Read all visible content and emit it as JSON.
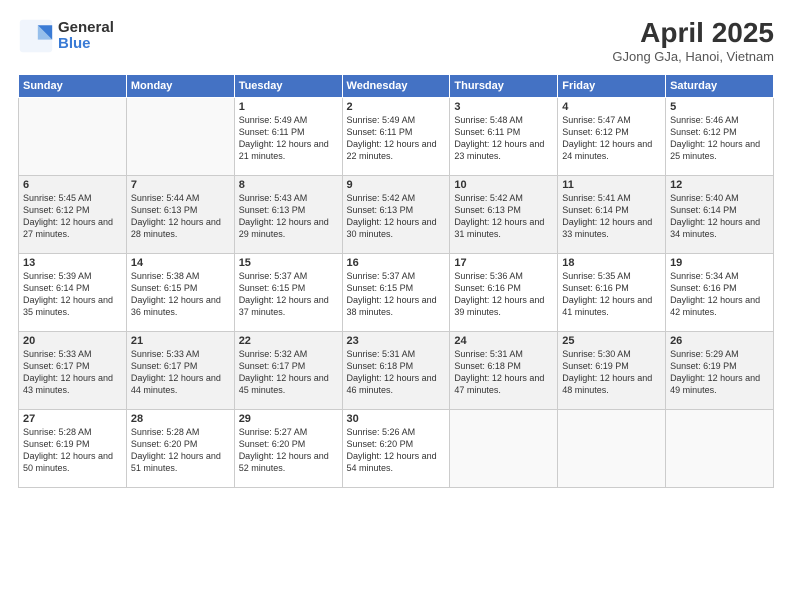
{
  "logo": {
    "general": "General",
    "blue": "Blue"
  },
  "title": "April 2025",
  "subtitle": "GJong GJa, Hanoi, Vietnam",
  "days_of_week": [
    "Sunday",
    "Monday",
    "Tuesday",
    "Wednesday",
    "Thursday",
    "Friday",
    "Saturday"
  ],
  "weeks": [
    [
      {
        "day": "",
        "info": ""
      },
      {
        "day": "",
        "info": ""
      },
      {
        "day": "1",
        "info": "Sunrise: 5:49 AM\nSunset: 6:11 PM\nDaylight: 12 hours and 21 minutes."
      },
      {
        "day": "2",
        "info": "Sunrise: 5:49 AM\nSunset: 6:11 PM\nDaylight: 12 hours and 22 minutes."
      },
      {
        "day": "3",
        "info": "Sunrise: 5:48 AM\nSunset: 6:11 PM\nDaylight: 12 hours and 23 minutes."
      },
      {
        "day": "4",
        "info": "Sunrise: 5:47 AM\nSunset: 6:12 PM\nDaylight: 12 hours and 24 minutes."
      },
      {
        "day": "5",
        "info": "Sunrise: 5:46 AM\nSunset: 6:12 PM\nDaylight: 12 hours and 25 minutes."
      }
    ],
    [
      {
        "day": "6",
        "info": "Sunrise: 5:45 AM\nSunset: 6:12 PM\nDaylight: 12 hours and 27 minutes."
      },
      {
        "day": "7",
        "info": "Sunrise: 5:44 AM\nSunset: 6:13 PM\nDaylight: 12 hours and 28 minutes."
      },
      {
        "day": "8",
        "info": "Sunrise: 5:43 AM\nSunset: 6:13 PM\nDaylight: 12 hours and 29 minutes."
      },
      {
        "day": "9",
        "info": "Sunrise: 5:42 AM\nSunset: 6:13 PM\nDaylight: 12 hours and 30 minutes."
      },
      {
        "day": "10",
        "info": "Sunrise: 5:42 AM\nSunset: 6:13 PM\nDaylight: 12 hours and 31 minutes."
      },
      {
        "day": "11",
        "info": "Sunrise: 5:41 AM\nSunset: 6:14 PM\nDaylight: 12 hours and 33 minutes."
      },
      {
        "day": "12",
        "info": "Sunrise: 5:40 AM\nSunset: 6:14 PM\nDaylight: 12 hours and 34 minutes."
      }
    ],
    [
      {
        "day": "13",
        "info": "Sunrise: 5:39 AM\nSunset: 6:14 PM\nDaylight: 12 hours and 35 minutes."
      },
      {
        "day": "14",
        "info": "Sunrise: 5:38 AM\nSunset: 6:15 PM\nDaylight: 12 hours and 36 minutes."
      },
      {
        "day": "15",
        "info": "Sunrise: 5:37 AM\nSunset: 6:15 PM\nDaylight: 12 hours and 37 minutes."
      },
      {
        "day": "16",
        "info": "Sunrise: 5:37 AM\nSunset: 6:15 PM\nDaylight: 12 hours and 38 minutes."
      },
      {
        "day": "17",
        "info": "Sunrise: 5:36 AM\nSunset: 6:16 PM\nDaylight: 12 hours and 39 minutes."
      },
      {
        "day": "18",
        "info": "Sunrise: 5:35 AM\nSunset: 6:16 PM\nDaylight: 12 hours and 41 minutes."
      },
      {
        "day": "19",
        "info": "Sunrise: 5:34 AM\nSunset: 6:16 PM\nDaylight: 12 hours and 42 minutes."
      }
    ],
    [
      {
        "day": "20",
        "info": "Sunrise: 5:33 AM\nSunset: 6:17 PM\nDaylight: 12 hours and 43 minutes."
      },
      {
        "day": "21",
        "info": "Sunrise: 5:33 AM\nSunset: 6:17 PM\nDaylight: 12 hours and 44 minutes."
      },
      {
        "day": "22",
        "info": "Sunrise: 5:32 AM\nSunset: 6:17 PM\nDaylight: 12 hours and 45 minutes."
      },
      {
        "day": "23",
        "info": "Sunrise: 5:31 AM\nSunset: 6:18 PM\nDaylight: 12 hours and 46 minutes."
      },
      {
        "day": "24",
        "info": "Sunrise: 5:31 AM\nSunset: 6:18 PM\nDaylight: 12 hours and 47 minutes."
      },
      {
        "day": "25",
        "info": "Sunrise: 5:30 AM\nSunset: 6:19 PM\nDaylight: 12 hours and 48 minutes."
      },
      {
        "day": "26",
        "info": "Sunrise: 5:29 AM\nSunset: 6:19 PM\nDaylight: 12 hours and 49 minutes."
      }
    ],
    [
      {
        "day": "27",
        "info": "Sunrise: 5:28 AM\nSunset: 6:19 PM\nDaylight: 12 hours and 50 minutes."
      },
      {
        "day": "28",
        "info": "Sunrise: 5:28 AM\nSunset: 6:20 PM\nDaylight: 12 hours and 51 minutes."
      },
      {
        "day": "29",
        "info": "Sunrise: 5:27 AM\nSunset: 6:20 PM\nDaylight: 12 hours and 52 minutes."
      },
      {
        "day": "30",
        "info": "Sunrise: 5:26 AM\nSunset: 6:20 PM\nDaylight: 12 hours and 54 minutes."
      },
      {
        "day": "",
        "info": ""
      },
      {
        "day": "",
        "info": ""
      },
      {
        "day": "",
        "info": ""
      }
    ]
  ]
}
